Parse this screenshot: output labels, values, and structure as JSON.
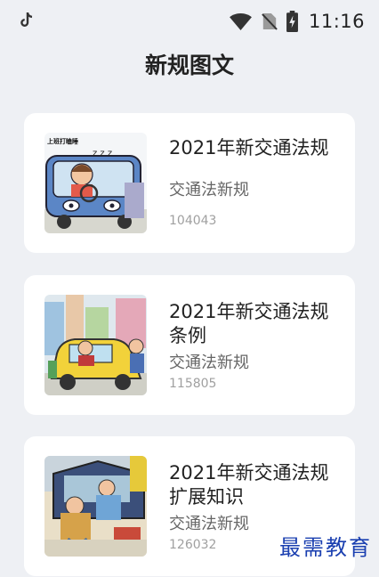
{
  "status_bar": {
    "time": "11:16",
    "icons": [
      "tiktok-icon",
      "wifi-icon",
      "no-sim-icon",
      "battery-charging-icon"
    ]
  },
  "page": {
    "title": "新规图文"
  },
  "articles": [
    {
      "title": "2021年新交通法规",
      "subtitle": "交通法新规",
      "count": "104043",
      "thumbnail_text": "上班打瞌睡"
    },
    {
      "title": "2021年新交通法规条例",
      "subtitle": "交通法新规",
      "count": "115805"
    },
    {
      "title": "2021年新交通法规扩展知识",
      "subtitle": "交通法新规",
      "count": "126032"
    }
  ],
  "watermark": "最需教育",
  "colors": {
    "background": "#eef0f4",
    "card": "#ffffff",
    "watermark": "#1a3fb0"
  }
}
